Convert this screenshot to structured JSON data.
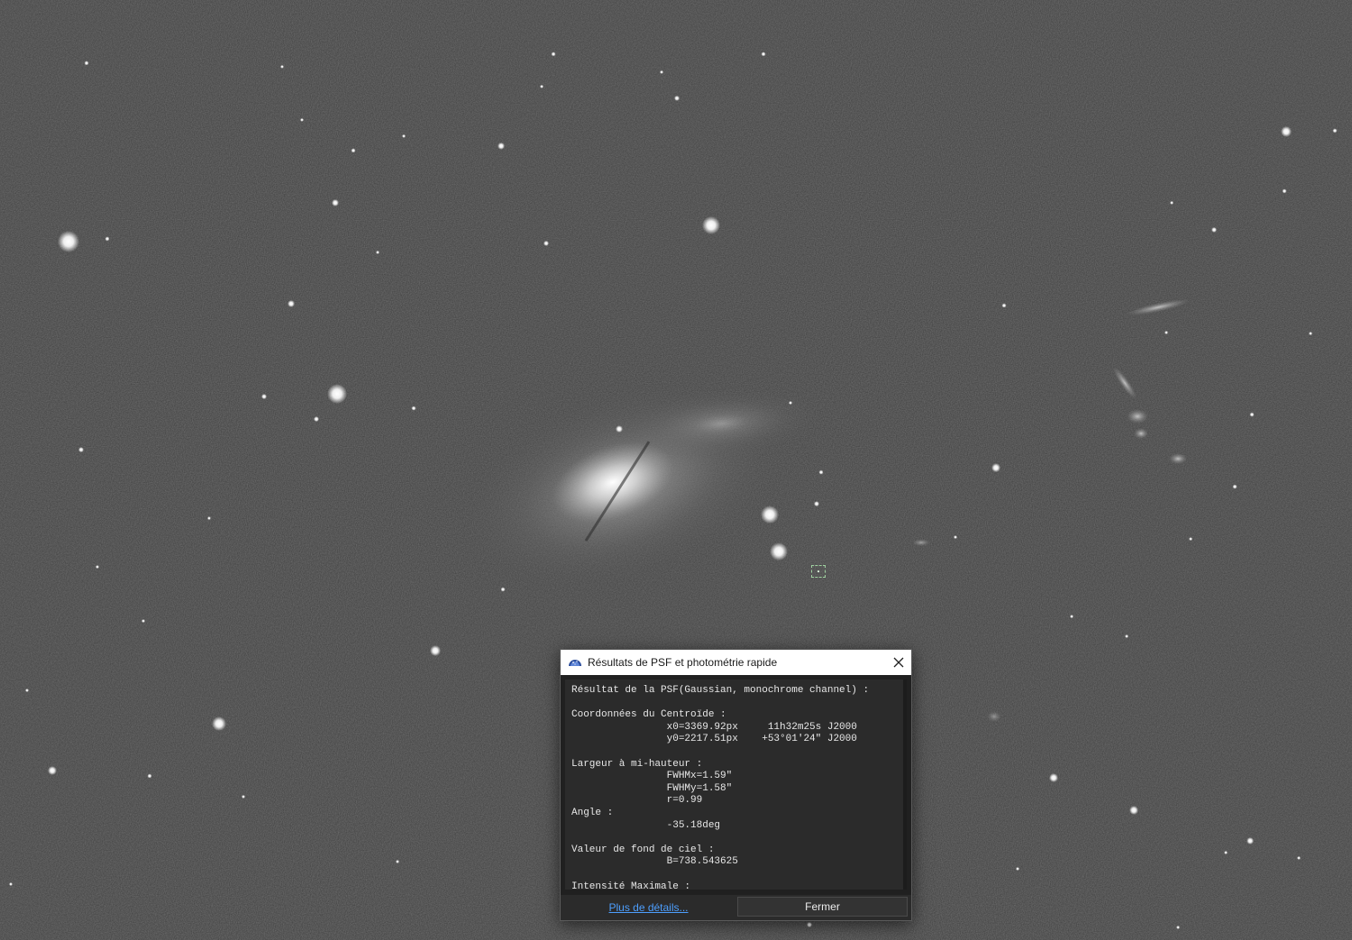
{
  "dialog": {
    "title": "Résultats de PSF et photométrie rapide",
    "icon": "siril-app-icon",
    "close_icon": "close-icon",
    "report_text": "Résultat de la PSF(Gaussian, monochrome channel) :\n\nCoordonnées du Centroïde :\n\t\tx0=3369.92px\t 11h32m25s J2000\n\t\ty0=2217.51px\t+53°01'24\" J2000\n\nLargeur à mi-hauteur :\n\t\tFWHMx=1.59\"\n\t\tFWHMy=1.58\"\n\t\tr=0.99\nAngle :\n\t\t-35.18deg\n\nValeur de fond de ciel :\n\t\tB=738.543625\n\nIntensité Maximale :",
    "details_link": "Plus de détails...",
    "close_button": "Fermer"
  },
  "colors": {
    "sky_background": "#3d3d3d",
    "dialog_background": "#202020",
    "text_area_background": "#2b2b2b",
    "link": "#4d9fff",
    "selection_box": "#9fd0a0"
  }
}
